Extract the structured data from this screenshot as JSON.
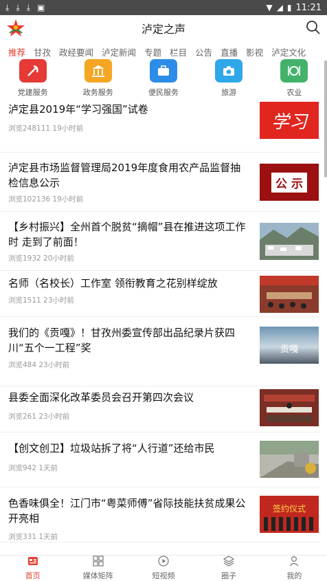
{
  "status": {
    "time": "11:21"
  },
  "app": {
    "title": "泸定之声"
  },
  "tabs": [
    "推荐",
    "甘孜",
    "政经要闻",
    "泸定新闻",
    "专题",
    "栏目",
    "公告",
    "直播",
    "影视",
    "泸定文化"
  ],
  "services": [
    {
      "label": "党建服务",
      "color": "#e53a35",
      "icon": "hammer-sickle-icon"
    },
    {
      "label": "政务服务",
      "color": "#f5a623",
      "icon": "government-building-icon"
    },
    {
      "label": "便民服务",
      "color": "#2d8ce8",
      "icon": "briefcase-icon"
    },
    {
      "label": "旅游",
      "color": "#2fa7e8",
      "icon": "camera-icon"
    },
    {
      "label": "农业",
      "color": "#43b36b",
      "icon": "dining-icon"
    }
  ],
  "feed": [
    {
      "title": "泸定县2019年“学习强国”试卷",
      "meta": "浏览248111 19小时前",
      "thumb_text": "学习"
    },
    {
      "title": "泸定县市场监督管理局2019年度食用农产品监督抽检信息公示",
      "meta": "浏览102136 19小时前",
      "thumb_text": "公 示"
    },
    {
      "title": "【乡村振兴】全州首个脱贫“摘帽”县在推进这项工作时 走到了前面！",
      "meta": "浏览1932 20小时前"
    },
    {
      "title": "名师（名校长）工作室 领衔教育之花别样绽放",
      "meta": "浏览1511 23小时前"
    },
    {
      "title": "我们的《贡嘎》！甘孜州委宣传部出品纪录片获四川“五个一工程”奖",
      "meta": "浏览484 23小时前",
      "thumb_text": "贡嘎"
    },
    {
      "title": "县委全面深化改革委员会召开第四次会议",
      "meta": "浏览261 23小时前"
    },
    {
      "title": "【创文创卫】垃圾站拆了将“人行道”还给市民",
      "meta": "浏览942 1天前"
    },
    {
      "title": "色香味俱全！江门市“粤菜师傅”省际技能扶贫成果公开亮相",
      "meta": "浏览331 1天前",
      "thumb_text": "签约仪式"
    }
  ],
  "bottom_nav": [
    {
      "label": "首页",
      "icon": "home-icon",
      "active": true
    },
    {
      "label": "媒体矩阵",
      "icon": "grid-icon",
      "active": false
    },
    {
      "label": "短视频",
      "icon": "play-icon",
      "active": false
    },
    {
      "label": "圈子",
      "icon": "layers-icon",
      "active": false
    },
    {
      "label": "我的",
      "icon": "user-icon",
      "active": false
    }
  ]
}
